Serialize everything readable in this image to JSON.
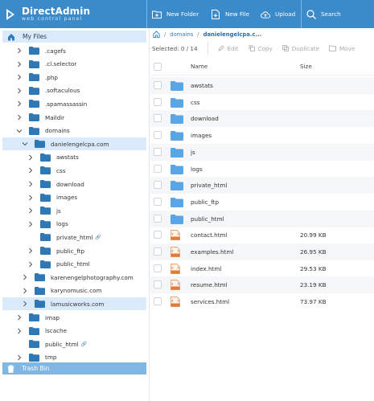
{
  "header": {
    "brand": "DirectAdmin",
    "tagline": "web control panel",
    "buttons": [
      {
        "label": "New Folder",
        "icon": "new-folder-icon"
      },
      {
        "label": "New File",
        "icon": "new-file-icon"
      },
      {
        "label": "Upload",
        "icon": "upload-icon"
      },
      {
        "label": "Search",
        "icon": "search-icon"
      }
    ]
  },
  "sidebar": {
    "root": "My Files",
    "trash": "Trash Bin",
    "items": [
      {
        "label": ".cagefs",
        "depth": 1,
        "expanded": false
      },
      {
        "label": ".cl.selector",
        "depth": 1,
        "expanded": false
      },
      {
        "label": ".php",
        "depth": 1,
        "expanded": false
      },
      {
        "label": ".softaculous",
        "depth": 1,
        "expanded": false
      },
      {
        "label": ".spamassassin",
        "depth": 1,
        "expanded": false
      },
      {
        "label": "Maildir",
        "depth": 1,
        "expanded": false
      },
      {
        "label": "domains",
        "depth": 1,
        "expanded": true
      },
      {
        "label": "danielengelcpa.com",
        "depth": 2,
        "expanded": true,
        "selected": true
      },
      {
        "label": "awstats",
        "depth": 3,
        "expanded": false
      },
      {
        "label": "css",
        "depth": 3,
        "expanded": false
      },
      {
        "label": "download",
        "depth": 3,
        "expanded": false
      },
      {
        "label": "images",
        "depth": 3,
        "expanded": false
      },
      {
        "label": "js",
        "depth": 3,
        "expanded": false
      },
      {
        "label": "logs",
        "depth": 3,
        "expanded": false
      },
      {
        "label": "private_html",
        "depth": 3,
        "link": true,
        "nochevron": true
      },
      {
        "label": "public_ftp",
        "depth": 3,
        "expanded": false
      },
      {
        "label": "public_html",
        "depth": 3,
        "expanded": false
      },
      {
        "label": "karenengelphotography.com",
        "depth": 2,
        "expanded": false
      },
      {
        "label": "karynomusic.com",
        "depth": 2,
        "expanded": false
      },
      {
        "label": "lamusicworks.com",
        "depth": 2,
        "expanded": false,
        "highlight": true
      },
      {
        "label": "imap",
        "depth": 1,
        "expanded": false
      },
      {
        "label": "lscache",
        "depth": 1,
        "expanded": false
      },
      {
        "label": "public_html",
        "depth": 1,
        "link": true,
        "nochevron": true
      },
      {
        "label": "tmp",
        "depth": 1,
        "expanded": false
      }
    ]
  },
  "breadcrumb": {
    "items": [
      "domains",
      "danielengelcpa.c..."
    ]
  },
  "toolbar": {
    "selected": "Selected: 0 / 14",
    "actions": [
      "Edit",
      "Copy",
      "Duplicate",
      "Move"
    ]
  },
  "table": {
    "columns": {
      "name": "Name",
      "size": "Size"
    },
    "rows": [
      {
        "name": "awstats",
        "type": "folder",
        "size": ""
      },
      {
        "name": "css",
        "type": "folder",
        "size": ""
      },
      {
        "name": "download",
        "type": "folder",
        "size": ""
      },
      {
        "name": "images",
        "type": "folder",
        "size": ""
      },
      {
        "name": "js",
        "type": "folder",
        "size": ""
      },
      {
        "name": "logs",
        "type": "folder",
        "size": ""
      },
      {
        "name": "private_html",
        "type": "folder",
        "size": ""
      },
      {
        "name": "public_ftp",
        "type": "folder",
        "size": ""
      },
      {
        "name": "public_html",
        "type": "folder",
        "size": ""
      },
      {
        "name": "contact.html",
        "type": "html",
        "size": "20.99 KB"
      },
      {
        "name": "examples.html",
        "type": "html",
        "size": "26.95 KB"
      },
      {
        "name": "index.html",
        "type": "html",
        "size": "29.53 KB"
      },
      {
        "name": "resume.html",
        "type": "html",
        "size": "23.19 KB"
      },
      {
        "name": "services.html",
        "type": "html",
        "size": "73.97 KB"
      }
    ]
  },
  "colors": {
    "header": "#3b8ac9",
    "folder": "#5aa5e6",
    "selected": "#dbeafa",
    "trash": "#7fb6e4"
  }
}
